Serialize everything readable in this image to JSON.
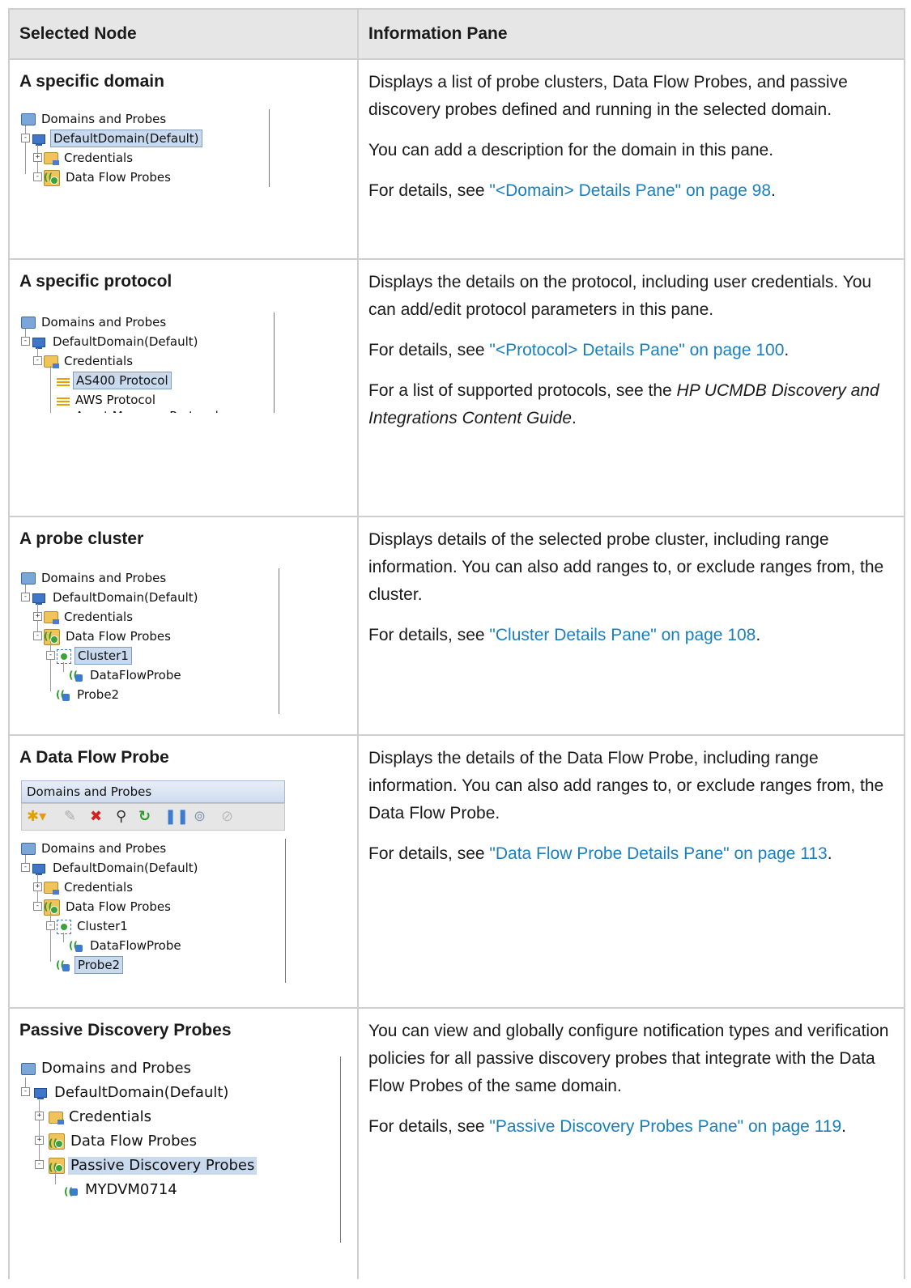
{
  "header": {
    "col1": "Selected Node",
    "col2": "Information Pane"
  },
  "rows": [
    {
      "node": "A specific domain",
      "tree": [
        "Domains and Probes",
        "DefaultDomain(Default)",
        "Credentials",
        "Data Flow Probes"
      ],
      "para1": "Displays a list of probe clusters, Data Flow Probes, and passive discovery probes defined and running in the selected domain.",
      "para2": "You can add a description for the domain in this pane.",
      "details_prefix": "For details, see ",
      "details_link": "\"<Domain> Details Pane\" on page 98",
      "details_suffix": "."
    },
    {
      "node": "A specific protocol",
      "tree": [
        "Domains and Probes",
        "DefaultDomain(Default)",
        "Credentials",
        "AS400 Protocol",
        "AWS Protocol",
        "Asset Manager Protocol"
      ],
      "para1": "Displays the details on the protocol, including user credentials. You can add/edit protocol parameters in this pane.",
      "details_prefix": "For details, see ",
      "details_link": "\"<Protocol> Details Pane\" on page 100",
      "details_suffix": ".",
      "list_prefix": "For a list of supported protocols, see the ",
      "list_em": "HP UCMDB Discovery and Integrations Content Guide",
      "list_suffix": "."
    },
    {
      "node": "A probe cluster",
      "tree": [
        "Domains and Probes",
        "DefaultDomain(Default)",
        "Credentials",
        "Data Flow Probes",
        "Cluster1",
        "DataFlowProbe",
        "Probe2"
      ],
      "para1": "Displays details of the selected probe cluster, including range information. You can also add ranges to, or exclude ranges from, the cluster.",
      "details_prefix": "For details, see ",
      "details_link": "\"Cluster Details Pane\" on page 108",
      "details_suffix": "."
    },
    {
      "node": "A Data Flow Probe",
      "panel_title": "Domains and Probes",
      "tree": [
        "Domains and Probes",
        "DefaultDomain(Default)",
        "Credentials",
        "Data Flow Probes",
        "Cluster1",
        "DataFlowProbe",
        "Probe2"
      ],
      "para1": "Displays the details of the Data Flow Probe, including range information. You can also add ranges to, or exclude ranges from, the Data Flow Probe.",
      "details_prefix": "For details, see ",
      "details_link": "\"Data Flow Probe Details Pane\" on page 113",
      "details_suffix": "."
    },
    {
      "node": "Passive Discovery Probes",
      "tree": [
        "Domains and Probes",
        "DefaultDomain(Default)",
        "Credentials",
        "Data Flow Probes",
        "Passive Discovery Probes",
        "MYDVM0714"
      ],
      "para1": "You can view and globally configure notification types and verification policies for all passive discovery probes that integrate with the Data Flow Probes of the same domain.",
      "details_prefix": "For details, see ",
      "details_link": "\"Passive Discovery Probes Pane\" on page 119",
      "details_suffix": "."
    }
  ],
  "toolbar_icons": [
    "new-icon",
    "edit-icon",
    "delete-icon",
    "find-icon",
    "refresh-icon",
    "pause-icon",
    "activate-icon",
    "deactivate-icon"
  ],
  "colors": {
    "link": "#1a7fbf",
    "header_bg": "#e6e6e6",
    "border": "#cfcfcf",
    "selection": "#c9d9ee"
  }
}
